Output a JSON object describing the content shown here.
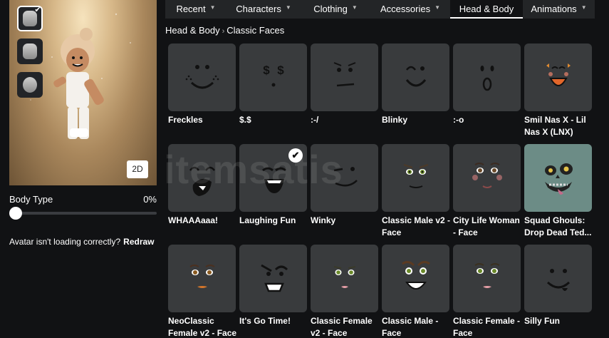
{
  "tabs": [
    {
      "label": "Recent"
    },
    {
      "label": "Characters"
    },
    {
      "label": "Clothing"
    },
    {
      "label": "Accessories"
    },
    {
      "label": "Head & Body"
    },
    {
      "label": "Animations"
    }
  ],
  "breadcrumb": {
    "parent": "Head & Body",
    "current": "Classic Faces"
  },
  "avatar_panel": {
    "view_toggle": "2D",
    "body_type_label": "Body Type",
    "body_type_value": "0%",
    "body_type_level": 0,
    "redraw_message": "Avatar isn't loading correctly?",
    "redraw_label": "Redraw"
  },
  "items": [
    {
      "name": "Freckles",
      "face": "freckles",
      "equipped": false
    },
    {
      "name": "$.$",
      "face": "dollar",
      "equipped": false
    },
    {
      "name": ":-/",
      "face": "meh",
      "equipped": false
    },
    {
      "name": "Blinky",
      "face": "blinky",
      "equipped": false
    },
    {
      "name": ":-o",
      "face": "surprised",
      "equipped": false
    },
    {
      "name": "Smil Nas X - Lil Nas X (LNX)",
      "face": "lnx",
      "equipped": false
    },
    {
      "name": "WHAAAaaa!",
      "face": "whaaa",
      "equipped": false
    },
    {
      "name": "Laughing Fun",
      "face": "laughing",
      "equipped": true
    },
    {
      "name": "Winky",
      "face": "winky",
      "equipped": false
    },
    {
      "name": "Classic Male v2 - Face",
      "face": "male-v2",
      "equipped": false
    },
    {
      "name": "City Life Woman - Face",
      "face": "city-woman",
      "equipped": false
    },
    {
      "name": "Squad Ghouls: Drop Dead Ted...",
      "face": "ghoul",
      "equipped": false
    },
    {
      "name": "NeoClassic Female v2 - Face",
      "face": "neo-female",
      "equipped": false
    },
    {
      "name": "It's Go Time!",
      "face": "go-time",
      "equipped": false
    },
    {
      "name": "Classic Female v2 - Face",
      "face": "female-v2",
      "equipped": false
    },
    {
      "name": "Classic Male - Face",
      "face": "male",
      "equipped": false
    },
    {
      "name": "Classic Female - Face",
      "face": "female",
      "equipped": false
    },
    {
      "name": "Silly Fun",
      "face": "silly",
      "equipped": false
    }
  ],
  "watermark": "itemsatis",
  "icons": {
    "check": "checkmark-icon",
    "chevron": "chevron-down-icon"
  }
}
